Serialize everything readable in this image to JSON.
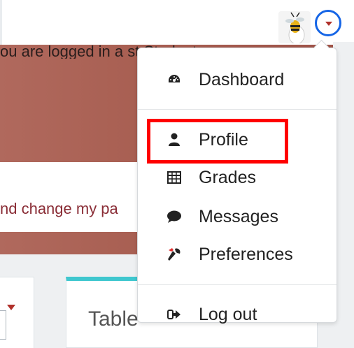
{
  "banner": {
    "top_text": "ou are logged in a        st Student",
    "link_text": "nd change my pa"
  },
  "card": {
    "title": "Table"
  },
  "user_menu": {
    "avatar_alt": "user avatar",
    "toggle_icon": "caret-down-icon",
    "items": [
      {
        "label": "Dashboard",
        "icon": "dashboard-gauge-icon"
      },
      {
        "label": "Profile",
        "icon": "user-icon"
      },
      {
        "label": "Grades",
        "icon": "table-grid-icon"
      },
      {
        "label": "Messages",
        "icon": "chat-bubble-icon"
      },
      {
        "label": "Preferences",
        "icon": "wrench-icon"
      },
      {
        "label": "Log out",
        "icon": "sign-out-icon"
      }
    ]
  },
  "colors": {
    "highlight": "#ff0000",
    "toggle_ring": "#1565e6",
    "accent_caret": "#b0302a",
    "banner": "#a85f52"
  }
}
